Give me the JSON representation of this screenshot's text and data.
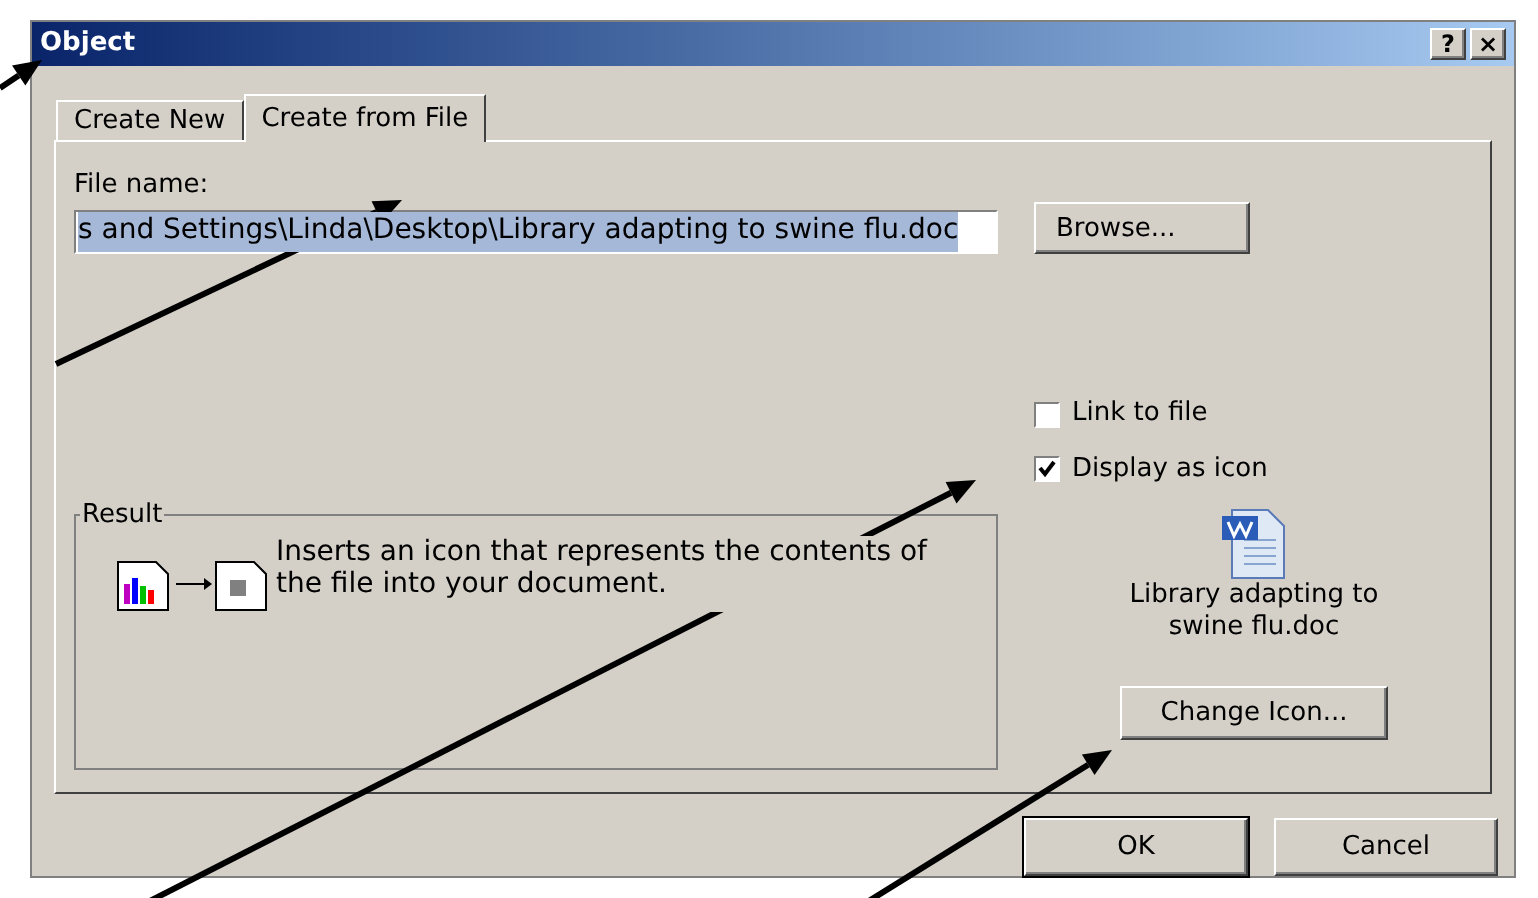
{
  "window": {
    "title": "Object",
    "title_buttons": [
      "?",
      "×"
    ]
  },
  "tabs": [
    {
      "label": "Create New",
      "selected": false
    },
    {
      "label": "Create from File",
      "selected": true
    }
  ],
  "file_name": {
    "label": "File name:",
    "value": "s and Settings\\Linda\\Desktop\\Library adapting to swine flu.doc"
  },
  "browse_button": "Browse...",
  "options": [
    {
      "label": "Link to file",
      "checked": false
    },
    {
      "label": "Display as icon",
      "checked": true
    }
  ],
  "result": {
    "title": "Result",
    "text": "Inserts an icon that represents the contents of the file into your document."
  },
  "icon_caption": "Library adapting to swine flu.doc",
  "change_icon_button": "Change Icon...",
  "buttons": [
    "OK",
    "Cancel"
  ]
}
